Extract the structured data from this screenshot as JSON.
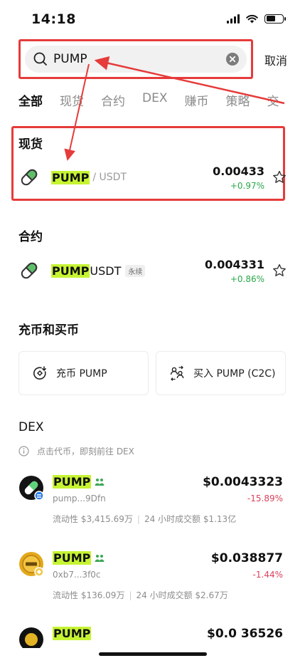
{
  "status_bar": {
    "time": "14:18"
  },
  "search": {
    "query": "PUMP",
    "cancel_label": "取消"
  },
  "tabs": [
    {
      "label": "全部",
      "active": true
    },
    {
      "label": "现货"
    },
    {
      "label": "合约"
    },
    {
      "label": "DEX"
    },
    {
      "label": "赚币"
    },
    {
      "label": "策略"
    },
    {
      "label": "交"
    }
  ],
  "spot": {
    "title": "现货",
    "item": {
      "base": "PUMP",
      "quote": "/ USDT",
      "price": "0.00433",
      "change": "+0.97%"
    }
  },
  "contract": {
    "title": "合约",
    "item": {
      "base": "PUMP",
      "quote": "USDT",
      "tag": "永续",
      "price": "0.004331",
      "change": "+0.86%"
    }
  },
  "deposit_buy": {
    "title": "充币和买币",
    "deposit_label": "充币 PUMP",
    "buy_label": "买入 PUMP (C2C)"
  },
  "dex": {
    "title": "DEX",
    "hint": "点击代币，即刻前往 DEX",
    "items": [
      {
        "name": "PUMP",
        "address": "pump...9Dfn",
        "liquidity": "流动性 $3,415.69万",
        "volume": "24 小时成交额 $1.13亿",
        "price": "$0.0043323",
        "change": "-15.89%"
      },
      {
        "name": "PUMP",
        "address": "0xb7...3f0c",
        "liquidity": "流动性 $136.09万",
        "volume": "24 小时成交额 $2.67万",
        "price": "$0.038877",
        "change": "-1.44%"
      },
      {
        "name": "PUMP",
        "price": "$0.0 36526"
      }
    ]
  },
  "colors": {
    "highlight": "#c6f432",
    "positive": "#2aa84a",
    "negative": "#d9415c",
    "annotation": "#e63b3b"
  }
}
